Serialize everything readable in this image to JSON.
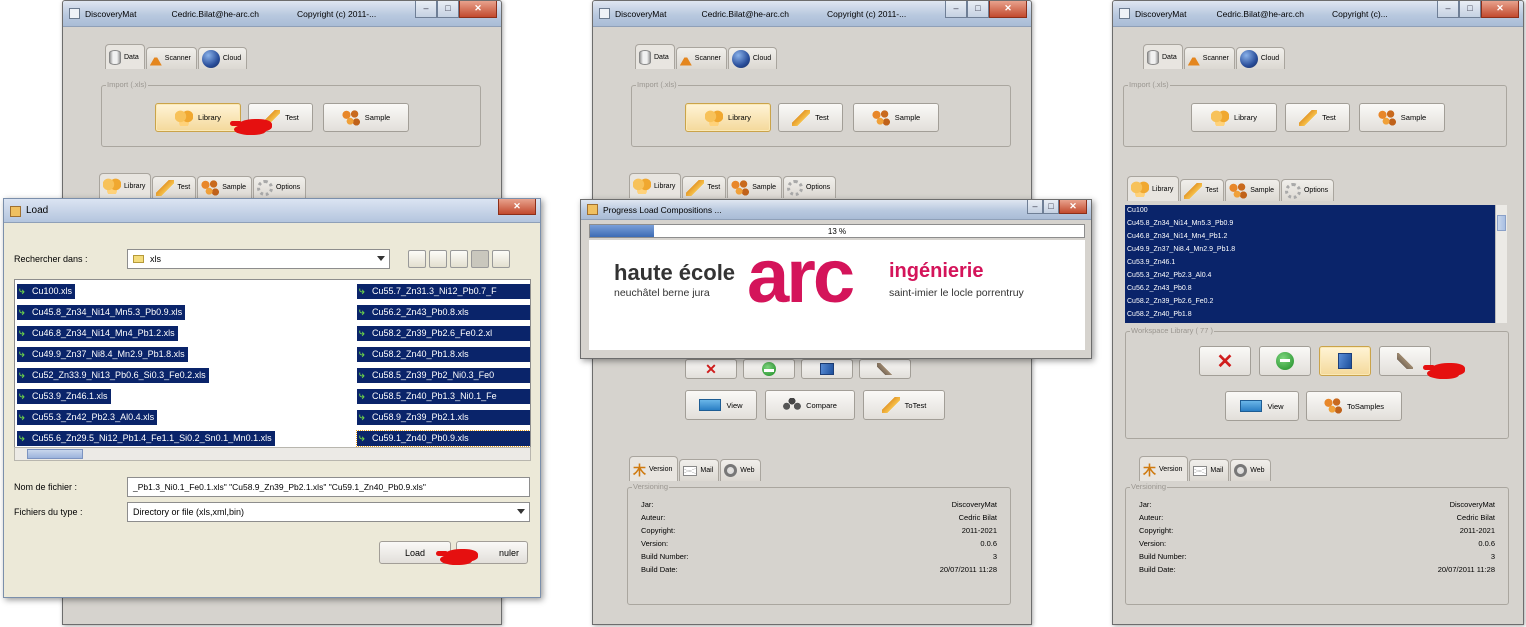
{
  "window": {
    "app_title": "DiscoveryMat",
    "email": "Cedric.Bilat@he-arc.ch",
    "copyright_left": "Copyright (c) 2011-...",
    "copyright_right": "Copyright (c)..."
  },
  "top_tabs": {
    "data": "Data",
    "scanner": "Scanner",
    "cloud": "Cloud"
  },
  "import_group": {
    "legend": "Import (.xls)",
    "library": "Library",
    "test": "Test",
    "sample": "Sample"
  },
  "lower_tabs": {
    "library": "Library",
    "test": "Test",
    "sample": "Sample",
    "options": "Options"
  },
  "load_dialog": {
    "title": "Load",
    "look_in_label": "Rechercher dans :",
    "look_in_value": "xls",
    "files_col1": [
      "Cu100.xls",
      "Cu45.8_Zn34_Ni14_Mn5.3_Pb0.9.xls",
      "Cu46.8_Zn34_Ni14_Mn4_Pb1.2.xls",
      "Cu49.9_Zn37_Ni8.4_Mn2.9_Pb1.8.xls",
      "Cu52_Zn33.9_Ni13_Pb0.6_Si0.3_Fe0.2.xls",
      "Cu53.9_Zn46.1.xls",
      "Cu55.3_Zn42_Pb2.3_Al0.4.xls",
      "Cu55.6_Zn29.5_Ni12_Pb1.4_Fe1.1_Si0.2_Sn0.1_Mn0.1.xls"
    ],
    "files_col2": [
      "Cu55.7_Zn31.3_Ni12_Pb0.7_F",
      "Cu56.2_Zn43_Pb0.8.xls",
      "Cu58.2_Zn39_Pb2.6_Fe0.2.xl",
      "Cu58.2_Zn40_Pb1.8.xls",
      "Cu58.5_Zn39_Pb2_Ni0.3_Fe0",
      "Cu58.5_Zn40_Pb1.3_Ni0.1_Fe",
      "Cu58.9_Zn39_Pb2.1.xls",
      "Cu59.1_Zn40_Pb0.9.xls"
    ],
    "filename_label": "Nom de fichier :",
    "filename_value": "_Pb1.3_Ni0.1_Fe0.1.xls\" \"Cu58.9_Zn39_Pb2.1.xls\" \"Cu59.1_Zn40_Pb0.9.xls\"",
    "filetype_label": "Fichiers du type :",
    "filetype_value": "Directory or file (xls,xml,bin)",
    "load_button": "Load",
    "cancel_button": "Annuler",
    "cancel_button_visible": "nuler"
  },
  "progress_dialog": {
    "title": "Progress Load Compositions ...",
    "percent_text": "13 %",
    "progress_fraction": 0.13,
    "logo_left_line1": "haute école",
    "logo_left_line2": "neuchâtel berne jura",
    "logo_arc": "arc",
    "logo_right_line1": "ingénierie",
    "logo_right_line2": "saint-imier le locle porrentruy"
  },
  "middle_actions": {
    "view": "View",
    "compare": "Compare",
    "totest": "ToTest"
  },
  "right_actions": {
    "view": "View",
    "tosamples": "ToSamples"
  },
  "workspace": {
    "legend": "Workspace Library ( 77 )",
    "items": [
      "Cu100",
      "Cu45.8_Zn34_Ni14_Mn5.3_Pb0.9",
      "Cu46.8_Zn34_Ni14_Mn4_Pb1.2",
      "Cu49.9_Zn37_Ni8.4_Mn2.9_Pb1.8",
      "Cu53.9_Zn46.1",
      "Cu55.3_Zn42_Pb2.3_Al0.4",
      "Cu56.2_Zn43_Pb0.8",
      "Cu58.2_Zn39_Pb2.6_Fe0.2",
      "Cu58.2_Zn40_Pb1.8"
    ]
  },
  "info_tabs": {
    "version": "Version",
    "mail": "Mail",
    "web": "Web"
  },
  "versioning": {
    "legend": "Versioning",
    "rows": [
      {
        "label": "Jar:",
        "value": "DiscoveryMat"
      },
      {
        "label": "Auteur:",
        "value": "Cedric Bilat"
      },
      {
        "label": "Copyright:",
        "value": "2011-2021"
      },
      {
        "label": "Version:",
        "value": "0.0.6"
      },
      {
        "label": "Build Number:",
        "value": "3"
      },
      {
        "label": "Build Date:",
        "value": "20/07/2011 11:28"
      }
    ]
  },
  "colors": {
    "selection": "#0a246a",
    "arc_magenta": "#d4145a",
    "pointer_red": "#e51010"
  }
}
